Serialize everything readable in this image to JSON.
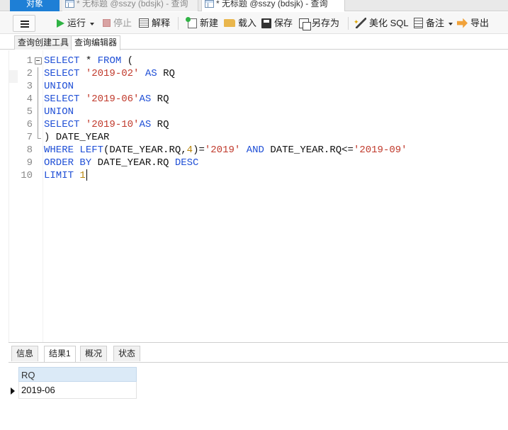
{
  "top_tabs": {
    "objects": "对象",
    "doc_tab_1": "* 无标题 @sszy (bdsjk) - 查询",
    "doc_tab_2": "* 无标题 @sszy (bdsjk) - 查询"
  },
  "toolbar": {
    "run": "运行",
    "stop": "停止",
    "explain": "解释",
    "new": "新建",
    "load": "载入",
    "save": "保存",
    "save_as": "另存为",
    "beautify": "美化 SQL",
    "memo": "备注",
    "export": "导出"
  },
  "sub_tabs": {
    "builder": "查询创建工具",
    "editor": "查询编辑器"
  },
  "editor": {
    "lines": [
      {
        "n": "1",
        "tokens": [
          {
            "t": "kw",
            "v": "SELECT"
          },
          {
            "t": "tx",
            "v": " * "
          },
          {
            "t": "kw",
            "v": "FROM"
          },
          {
            "t": "tx",
            "v": " ("
          }
        ]
      },
      {
        "n": "2",
        "tokens": [
          {
            "t": "kw",
            "v": "SELECT"
          },
          {
            "t": "tx",
            "v": " "
          },
          {
            "t": "str",
            "v": "'2019-02'"
          },
          {
            "t": "tx",
            "v": " "
          },
          {
            "t": "kw",
            "v": "AS"
          },
          {
            "t": "tx",
            "v": " RQ"
          }
        ]
      },
      {
        "n": "3",
        "tokens": [
          {
            "t": "kw",
            "v": "UNION"
          }
        ]
      },
      {
        "n": "4",
        "tokens": [
          {
            "t": "kw",
            "v": "SELECT"
          },
          {
            "t": "tx",
            "v": " "
          },
          {
            "t": "str",
            "v": "'2019-06'"
          },
          {
            "t": "kw",
            "v": "AS"
          },
          {
            "t": "tx",
            "v": " RQ"
          }
        ]
      },
      {
        "n": "5",
        "tokens": [
          {
            "t": "kw",
            "v": "UNION"
          }
        ]
      },
      {
        "n": "6",
        "tokens": [
          {
            "t": "kw",
            "v": "SELECT"
          },
          {
            "t": "tx",
            "v": " "
          },
          {
            "t": "str",
            "v": "'2019-10'"
          },
          {
            "t": "kw",
            "v": "AS"
          },
          {
            "t": "tx",
            "v": " RQ"
          }
        ]
      },
      {
        "n": "7",
        "tokens": [
          {
            "t": "tx",
            "v": ") DATE_YEAR"
          }
        ]
      },
      {
        "n": "8",
        "tokens": [
          {
            "t": "kw",
            "v": "WHERE"
          },
          {
            "t": "tx",
            "v": " "
          },
          {
            "t": "kw",
            "v": "LEFT"
          },
          {
            "t": "tx",
            "v": "(DATE_YEAR.RQ,"
          },
          {
            "t": "num",
            "v": "4"
          },
          {
            "t": "tx",
            "v": ")="
          },
          {
            "t": "str",
            "v": "'2019'"
          },
          {
            "t": "tx",
            "v": " "
          },
          {
            "t": "kw",
            "v": "AND"
          },
          {
            "t": "tx",
            "v": " DATE_YEAR.RQ<="
          },
          {
            "t": "str",
            "v": "'2019-09'"
          }
        ]
      },
      {
        "n": "9",
        "tokens": [
          {
            "t": "kw",
            "v": "ORDER BY"
          },
          {
            "t": "tx",
            "v": " DATE_YEAR.RQ "
          },
          {
            "t": "kw",
            "v": "DESC"
          }
        ]
      },
      {
        "n": "10",
        "tokens": [
          {
            "t": "kw",
            "v": "LIMIT"
          },
          {
            "t": "tx",
            "v": " "
          },
          {
            "t": "num",
            "v": "1"
          }
        ]
      }
    ]
  },
  "bottom_tabs": {
    "info": "信息",
    "result1": "结果1",
    "profile": "概况",
    "status": "状态"
  },
  "result": {
    "columns": [
      "RQ"
    ],
    "rows": [
      [
        "2019-06"
      ]
    ]
  },
  "colors": {
    "keyword": "#1f4fd6",
    "string": "#c0392b",
    "number": "#b8860b",
    "active_tab": "#1e7fd6",
    "grid_header": "#dbeaf7"
  }
}
